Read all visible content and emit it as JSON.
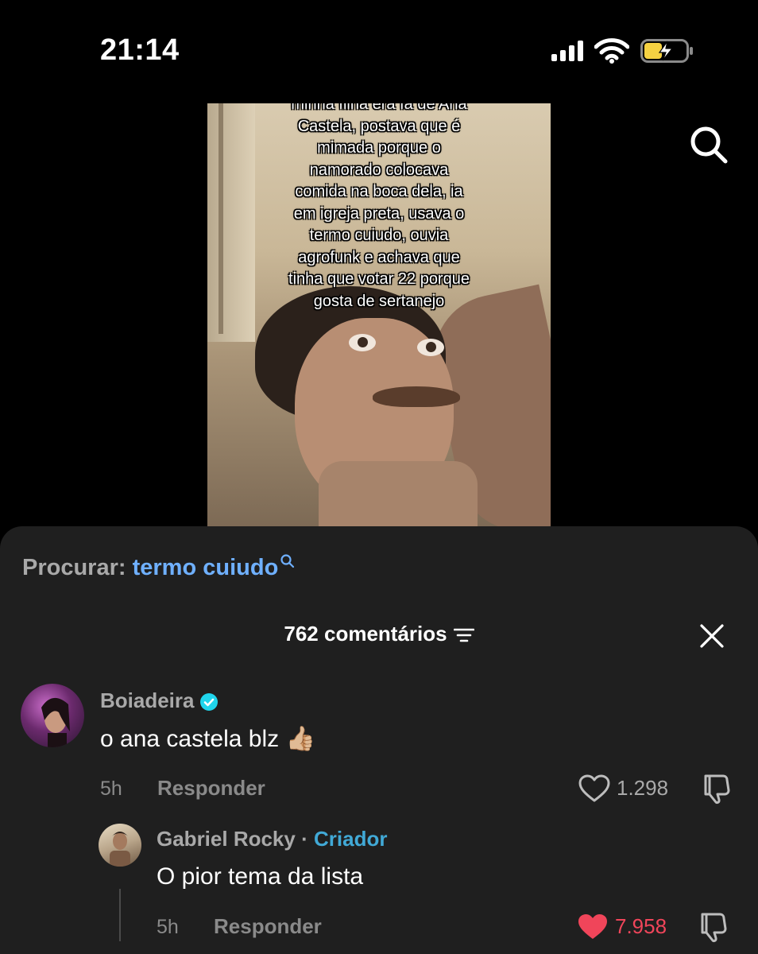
{
  "status": {
    "time": "21:14"
  },
  "video": {
    "caption_lines": [
      "minha filha era fã de Ana",
      "Castela, postava que é",
      "mimada porque o",
      "namorado colocava",
      "comida na boca dela, ia",
      "em igreja preta, usava o",
      "termo cuiudo, ouvia",
      "agrofunk e achava que",
      "tinha que votar 22 porque",
      "gosta de sertanejo"
    ]
  },
  "search_suggestion": {
    "label": "Procurar:",
    "term": "termo cuiudo"
  },
  "comments_header": {
    "count_label": "762 comentários"
  },
  "comments": [
    {
      "username": "Boiadeira",
      "verified": true,
      "text": "o ana castela blz 👍🏼",
      "time": "5h",
      "reply_label": "Responder",
      "likes": "1.298",
      "liked": false
    }
  ],
  "replies": [
    {
      "username": "Gabriel Rocky",
      "separator": "·",
      "tag": "Criador",
      "text": "O pior tema da lista",
      "time": "5h",
      "reply_label": "Responder",
      "likes": "7.958",
      "liked": true
    }
  ],
  "colors": {
    "accent_link": "#6fb0ff",
    "creator": "#41a9d6",
    "liked_heart": "#f0455a",
    "sheet_bg": "#1f1f1f"
  }
}
